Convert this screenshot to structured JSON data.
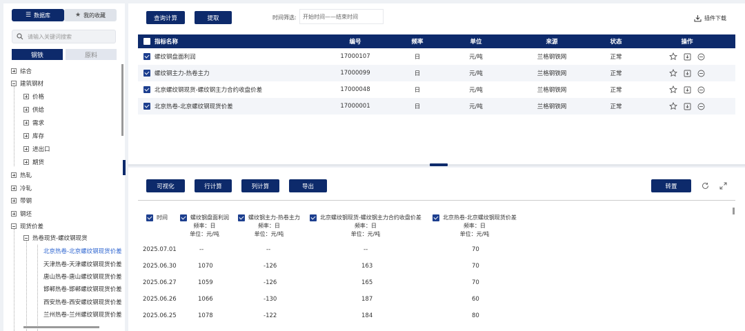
{
  "sidebar": {
    "tab_database": "数据库",
    "tab_favorites": "我的收藏",
    "search_placeholder": "请输入关键词搜索",
    "category_steel": "钢铁",
    "category_raw": "原料",
    "tree": {
      "comprehensive": "综合",
      "building": "建筑钢材",
      "building_children": [
        "价格",
        "供给",
        "需求",
        "库存",
        "进出口",
        "期货"
      ],
      "hot_rolled": "热轧",
      "cold_rolled": "冷轧",
      "strip": "带钢",
      "billet": "钢坯",
      "spot_spread": "现货价差",
      "spot_spread_child": "热卷现货-螺纹钢现货",
      "spread_leaves": [
        "北京热卷-北京螺纹钢现货价差",
        "天津热卷-天津螺纹钢现货价差",
        "唐山热卷-唐山螺纹钢现货价差",
        "邯郸热卷-邯郸螺纹钢现货价差",
        "西安热卷-西安螺纹钢现货价差",
        "兰州热卷-兰州螺纹钢现货价差"
      ]
    }
  },
  "top": {
    "btn_query": "查询计算",
    "btn_extract": "提取",
    "time_filter_label": "时间筛选:",
    "time_filter_value": "开始时间——结束时间",
    "plugin_download": "插件下载",
    "headers": [
      "指标名称",
      "编号",
      "频率",
      "单位",
      "来源",
      "状态",
      "操作"
    ],
    "rows": [
      {
        "name": "螺纹钢盘面利润",
        "code": "17000107",
        "freq": "日",
        "unit": "元/吨",
        "source": "兰格钢铁网",
        "status": "正常"
      },
      {
        "name": "螺纹钢主力-热卷主力",
        "code": "17000099",
        "freq": "日",
        "unit": "元/吨",
        "source": "兰格钢铁网",
        "status": "正常"
      },
      {
        "name": "北京螺纹钢现货-螺纹钢主力合约收盘价差",
        "code": "17000048",
        "freq": "日",
        "unit": "元/吨",
        "source": "兰格钢铁网",
        "status": "正常"
      },
      {
        "name": "北京热卷-北京螺纹钢现货价差",
        "code": "17000001",
        "freq": "日",
        "unit": "元/吨",
        "source": "兰格钢铁网",
        "status": "正常"
      }
    ]
  },
  "bottom": {
    "btn_visualize": "可视化",
    "btn_row_calc": "行计算",
    "btn_col_calc": "列计算",
    "btn_export": "导出",
    "btn_transpose": "转置",
    "col_time": "时间",
    "columns": [
      {
        "name": "螺纹钢盘面利润",
        "freq": "频率：日",
        "unit": "单位：元/吨"
      },
      {
        "name": "螺纹钢主力-热卷主力",
        "freq": "频率：日",
        "unit": "单位：元/吨"
      },
      {
        "name": "北京螺纹钢现货-螺纹钢主力合约收盘价差",
        "freq": "频率：日",
        "unit": "单位：元/吨"
      },
      {
        "name": "北京热卷-北京螺纹钢现货价差",
        "freq": "频率：日",
        "unit": "单位：元/吨"
      }
    ],
    "rows": [
      {
        "date": "2025.07.01",
        "v1": "--",
        "v2": "--",
        "v3": "--",
        "v4": "70"
      },
      {
        "date": "2025.06.30",
        "v1": "1070",
        "v2": "-126",
        "v3": "163",
        "v4": "70"
      },
      {
        "date": "2025.06.27",
        "v1": "1059",
        "v2": "-126",
        "v3": "165",
        "v4": "70"
      },
      {
        "date": "2025.06.26",
        "v1": "1066",
        "v2": "-130",
        "v3": "187",
        "v4": "60"
      },
      {
        "date": "2025.06.25",
        "v1": "1078",
        "v2": "-122",
        "v3": "184",
        "v4": "80"
      }
    ]
  },
  "colors": {
    "primary": "#0d2a6b",
    "link": "#2f66d0"
  }
}
